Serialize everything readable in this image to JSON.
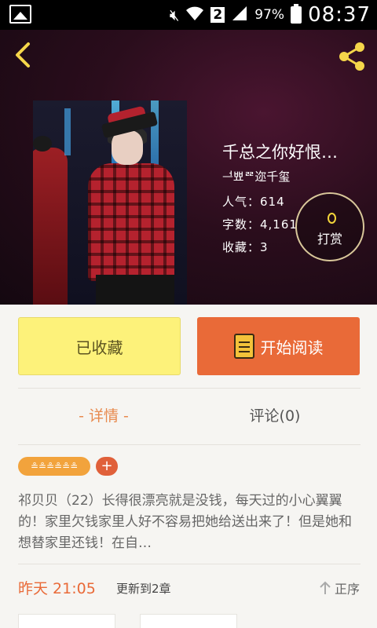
{
  "status_bar": {
    "signal_badge": "2",
    "battery": "97%",
    "time": "08:37"
  },
  "book": {
    "title": "千总之你好恨…",
    "author": "ᅼ뾰ᄙ迩千玺",
    "stats": {
      "popularity": "人气：614",
      "word_count": "字数：4,161",
      "favorites": "收藏：3"
    },
    "reward_label": "打赏"
  },
  "actions": {
    "collected_label": "已收藏",
    "read_label": "开始阅读"
  },
  "tabs": {
    "details_label": "- 详情 -",
    "comments_label": "评论(0)"
  },
  "tags": {
    "tag_label": "≗≗≗≗≗≗",
    "add_label": "+"
  },
  "synopsis": "祁贝贝（22）长得很漂亮就是没钱，每天过的小心翼翼的！家里欠钱家里人好不容易把她给送出来了！但是她和想替家里还钱！在自…",
  "update": {
    "time": "昨天 21:05",
    "chapter": "更新到2章",
    "order_label": "正序"
  },
  "icons": {
    "back": "chevron-left-icon",
    "share": "share-icon",
    "reward": "coin-icon",
    "read": "book-icon",
    "order": "arrow-up-icon"
  },
  "colors": {
    "accent_orange": "#e96a38",
    "tab_active": "#e88a4e",
    "collected_yellow": "#fdf27a",
    "icon_yellow": "#f5d64a"
  }
}
